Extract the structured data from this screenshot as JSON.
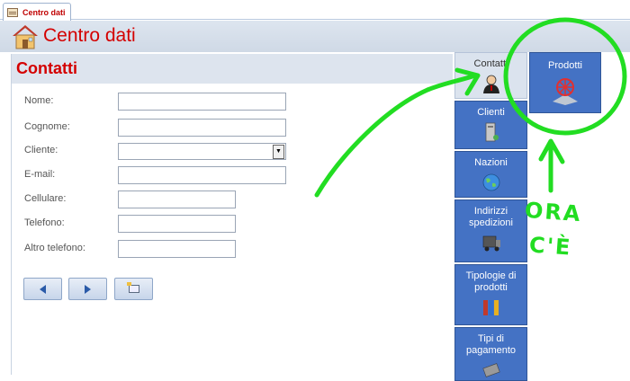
{
  "tabstrip": {
    "doc_tab_label": "Centro dati"
  },
  "header": {
    "title": "Centro dati"
  },
  "form": {
    "title": "Contatti",
    "fields": [
      {
        "label": "Nome:",
        "value": ""
      },
      {
        "label": "Cognome:",
        "value": ""
      },
      {
        "label": "Cliente:",
        "value": ""
      },
      {
        "label": "E-mail:",
        "value": ""
      },
      {
        "label": "Cellulare:",
        "value": ""
      },
      {
        "label": "Telefono:",
        "value": ""
      },
      {
        "label": "Altro telefono:",
        "value": ""
      }
    ]
  },
  "nav": {
    "items": [
      {
        "label": "Contatti",
        "icon": "contact-person-icon",
        "active": true
      },
      {
        "label": "Clienti",
        "icon": "server-icon"
      },
      {
        "label": "Nazioni",
        "icon": "globe-icon"
      },
      {
        "label": "Indirizzi spedizioni",
        "icon": "truck-icon"
      },
      {
        "label": "Tipologie di prodotti",
        "icon": "binders-icon"
      },
      {
        "label": "Tipi di pagamento",
        "icon": "payment-icon"
      }
    ]
  },
  "products_tab": {
    "label": "Prodotti",
    "icon": "products-icon"
  },
  "annotation": {
    "line1": "ORA",
    "line2": "C'È",
    "color": "#22dd22"
  },
  "colors": {
    "accent_red": "#d40000",
    "nav_blue": "#4472c4",
    "annotation_green": "#22dd22"
  }
}
